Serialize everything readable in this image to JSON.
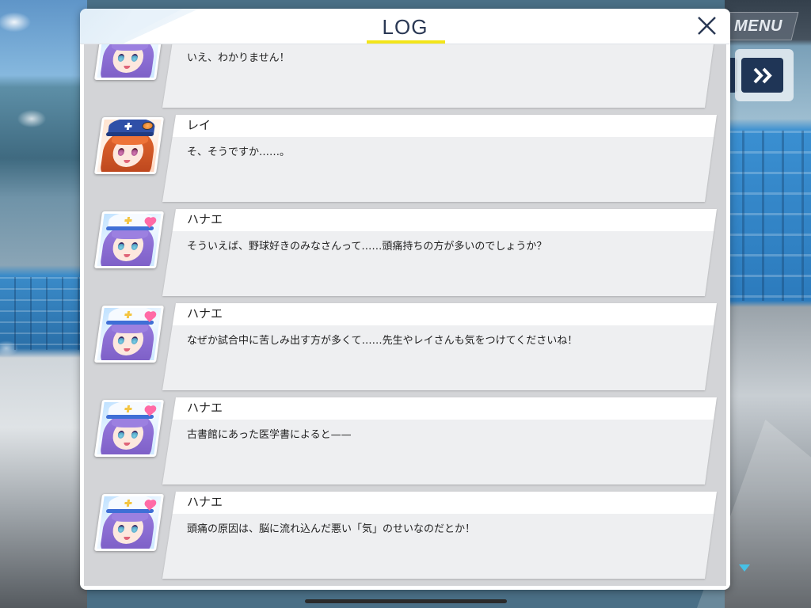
{
  "log_panel": {
    "title": "LOG",
    "icons": {
      "close": "close-icon"
    },
    "entries": [
      {
        "portrait": "hanae-portrait-icon",
        "text": "いえ、わかりません！"
      },
      {
        "portrait": "rei-portrait-icon",
        "speaker": "レイ",
        "text": "そ、そうですか……。"
      },
      {
        "portrait": "hanae-portrait-icon",
        "speaker": "ハナエ",
        "text": "そういえば、野球好きのみなさんって……頭痛持ちの方が多いのでしょうか？"
      },
      {
        "portrait": "hanae-portrait-icon",
        "speaker": "ハナエ",
        "text": "なぜか試合中に苦しみ出す方が多くて……先生やレイさんも気をつけてくださいね！"
      },
      {
        "portrait": "hanae-portrait-icon",
        "speaker": "ハナエ",
        "text": "古書館にあった医学書によると——"
      },
      {
        "portrait": "hanae-portrait-icon",
        "speaker": "ハナエ",
        "text": "頭痛の原因は、脳に流れ込んだ悪い「気」のせいなのだとか！"
      }
    ]
  },
  "game_hud": {
    "menu_label": "MENU",
    "icons": {
      "fast_forward": "fast-forward-icon",
      "next": "next-indicator-icon"
    }
  },
  "colors": {
    "title_navy": "#2a3854",
    "accent_yellow": "#f3e51a",
    "log_background": "#d3d4d7",
    "card_name_band": "#ffffff",
    "card_body": "#eeeff1",
    "button_navy": "#1f3556",
    "next_indicator": "#46c1e6"
  }
}
